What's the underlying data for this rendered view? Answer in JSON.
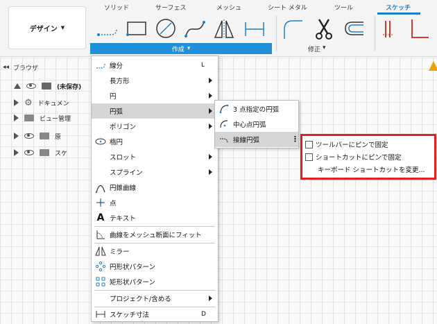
{
  "ribbon": {
    "workspace_label": "デザイン",
    "tabs": [
      "ソリッド",
      "サーフェス",
      "メッシュ",
      "シート メタル",
      "ツール",
      "スケッチ"
    ],
    "active_tab": "スケッチ",
    "create_label": "作成",
    "modify_label": "修正",
    "accent_color": "#1e8fd8"
  },
  "browser": {
    "title": "ブラウザ",
    "rows": [
      {
        "label": "(未保存)"
      },
      {
        "label": "ドキュメン"
      },
      {
        "label": "ビュー管理"
      },
      {
        "label": "原"
      },
      {
        "label": "スケ"
      }
    ]
  },
  "menu": {
    "items": [
      {
        "label": "線分",
        "shortcut": "L",
        "icon": "line-icon"
      },
      {
        "label": "長方形",
        "submenu": true
      },
      {
        "label": "円",
        "submenu": true
      },
      {
        "label": "円弧",
        "submenu": true,
        "highlighted": true
      },
      {
        "label": "ポリゴン",
        "submenu": true
      },
      {
        "label": "楕円",
        "icon": "ellipse-icon"
      },
      {
        "label": "スロット",
        "submenu": true
      },
      {
        "label": "スプライン",
        "submenu": true
      },
      {
        "label": "円錐曲線",
        "icon": "conic-icon"
      },
      {
        "label": "点",
        "icon": "point-icon"
      },
      {
        "label": "テキスト",
        "icon": "text-icon"
      },
      {
        "label": "曲線をメッシュ断面にフィット",
        "icon": "mesh-fit-icon"
      },
      {
        "label": "ミラー",
        "icon": "mirror-icon"
      },
      {
        "label": "円形状パターン",
        "icon": "circular-pattern-icon"
      },
      {
        "label": "矩形状パターン",
        "icon": "rect-pattern-icon"
      },
      {
        "label": "プロジェクト/含める",
        "submenu": true
      },
      {
        "label": "スケッチ寸法",
        "shortcut": "D",
        "icon": "dimension-icon"
      }
    ]
  },
  "arc_submenu": {
    "items": [
      {
        "label": "3 点指定の円弧"
      },
      {
        "label": "中心点円弧"
      },
      {
        "label": "接線円弧",
        "highlighted": true
      }
    ]
  },
  "pin_menu": {
    "pin_toolbar": "ツールバーにピンで固定",
    "pin_shortcut": "ショートカットにピンで固定",
    "change_shortcut": "キーボード ショートカットを変更..."
  },
  "highlight_border_color": "#e02020"
}
